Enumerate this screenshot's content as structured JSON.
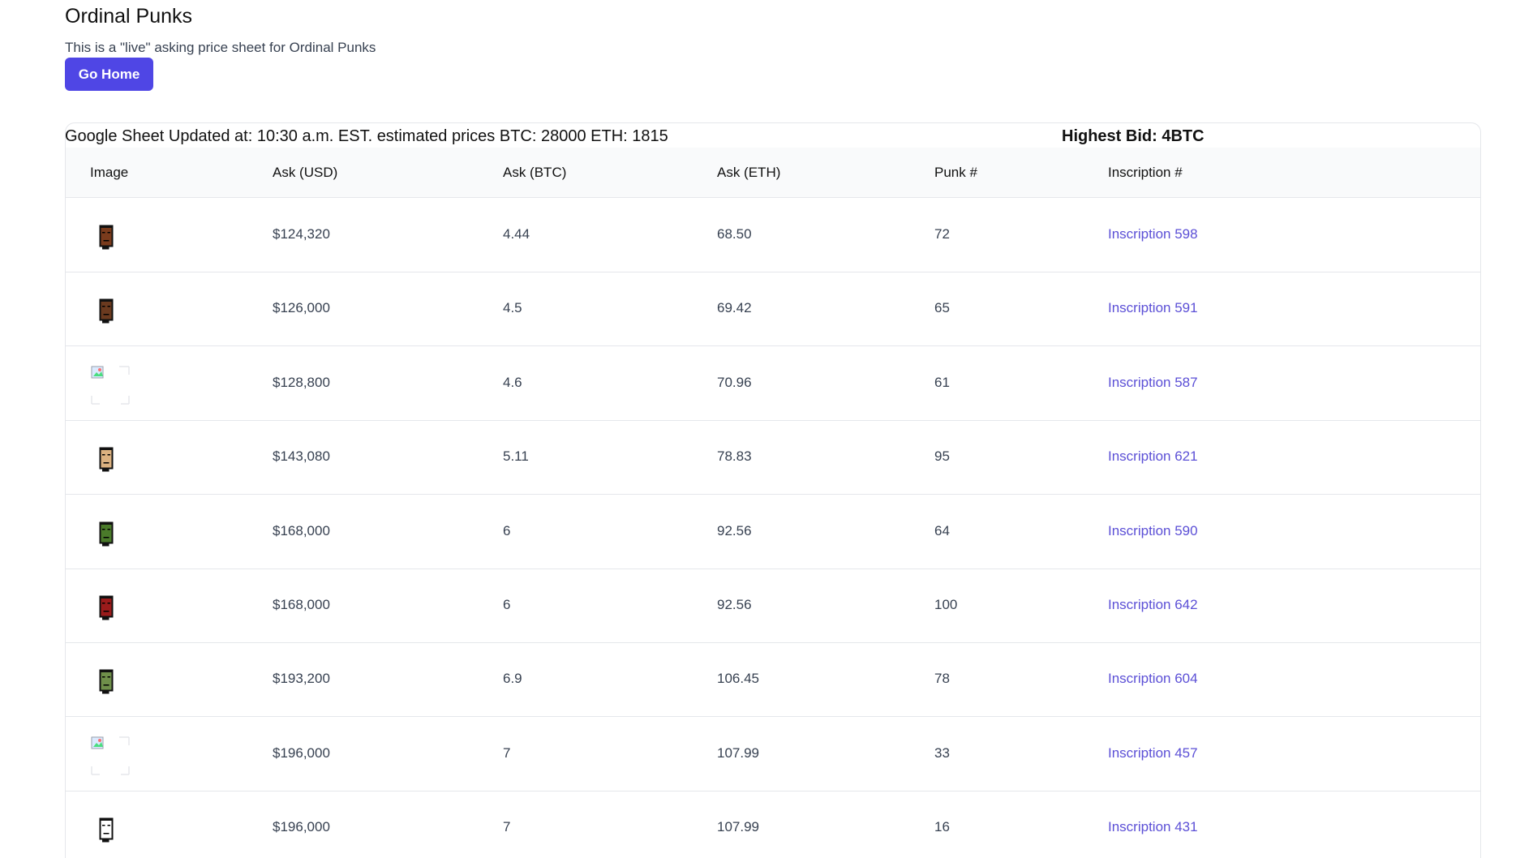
{
  "header": {
    "title": "Ordinal Punks",
    "subtitle": "This is a \"live\" asking price sheet for Ordinal Punks",
    "home_button": "Go Home"
  },
  "sheet": {
    "updated_text": "Google Sheet Updated at: 10:30 a.m. EST. estimated prices BTC: 28000 ETH: 1815",
    "highest_bid": "Highest Bid: 4BTC"
  },
  "table": {
    "columns": [
      "Image",
      "Ask (USD)",
      "Ask (BTC)",
      "Ask (ETH)",
      "Punk #",
      "Inscription #"
    ],
    "rows": [
      {
        "usd": "$124,320",
        "btc": "4.44",
        "eth": "68.50",
        "punk": "72",
        "inscription": "Inscription 598",
        "image": "punk-female-dark-hair-icon",
        "color": "#7a3b1c"
      },
      {
        "usd": "$126,000",
        "btc": "4.5",
        "eth": "69.42",
        "punk": "65",
        "inscription": "Inscription 591",
        "image": "punk-male-cap-icon",
        "color": "#6b3a1f"
      },
      {
        "usd": "$128,800",
        "btc": "4.6",
        "eth": "70.96",
        "punk": "61",
        "inscription": "Inscription 587",
        "image": "broken-image-icon",
        "color": ""
      },
      {
        "usd": "$143,080",
        "btc": "5.11",
        "eth": "78.83",
        "punk": "95",
        "inscription": "Inscription 621",
        "image": "punk-bald-pipe-icon",
        "color": "#dbb180"
      },
      {
        "usd": "$168,000",
        "btc": "6",
        "eth": "92.56",
        "punk": "64",
        "inscription": "Inscription 590",
        "image": "punk-zombie-hair-icon",
        "color": "#4a7a2a"
      },
      {
        "usd": "$168,000",
        "btc": "6",
        "eth": "92.56",
        "punk": "100",
        "inscription": "Inscription 642",
        "image": "punk-red-cowboy-icon",
        "color": "#9b1b1b"
      },
      {
        "usd": "$193,200",
        "btc": "6.9",
        "eth": "106.45",
        "punk": "78",
        "inscription": "Inscription 604",
        "image": "punk-zombie-hood-icon",
        "color": "#6f8f4a"
      },
      {
        "usd": "$196,000",
        "btc": "7",
        "eth": "107.99",
        "punk": "33",
        "inscription": "Inscription 457",
        "image": "broken-image-icon",
        "color": ""
      },
      {
        "usd": "$196,000",
        "btc": "7",
        "eth": "107.99",
        "punk": "16",
        "inscription": "Inscription 431",
        "image": "punk-outline-icon",
        "color": "#ffffff"
      }
    ]
  },
  "colors": {
    "accent": "#4f46e5",
    "link": "#5b4fd6",
    "border": "#e5e7eb",
    "header_bg": "#f9fafb"
  }
}
